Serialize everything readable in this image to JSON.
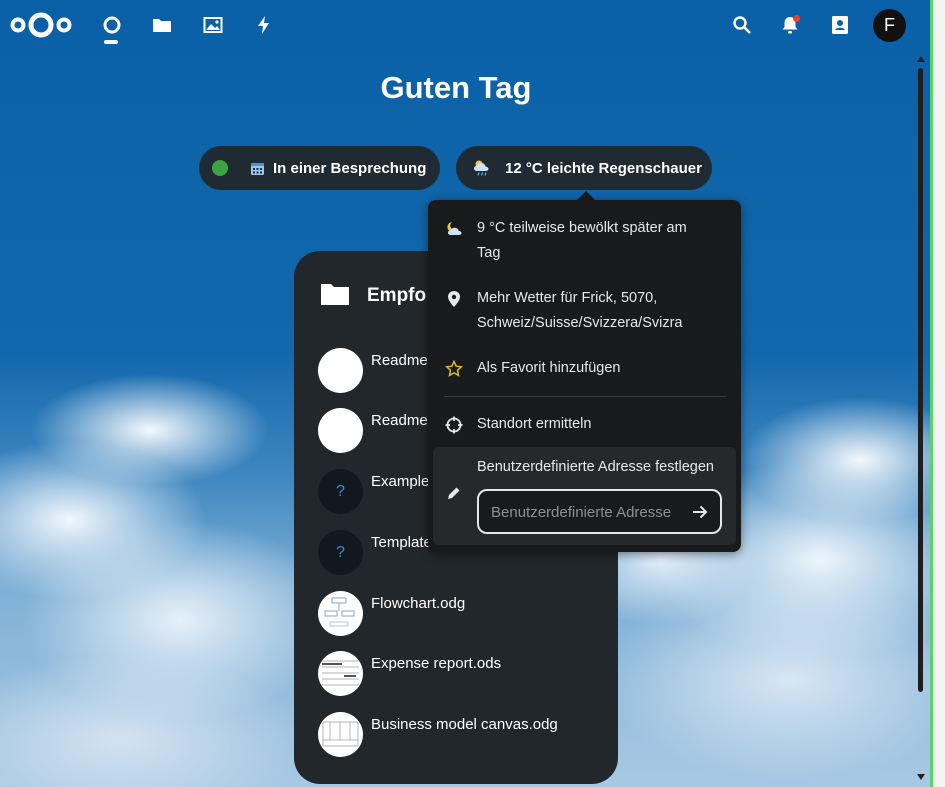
{
  "greeting": "Guten Tag",
  "colors": {
    "header_bg": "#0a60a6",
    "pill_bg": "#1f2a33",
    "status_green": "#3aa542",
    "notification_dot": "#e9432b",
    "panel_bg": "#22272b",
    "popover_bg": "#191a1c"
  },
  "header": {
    "nav": [
      {
        "name": "dashboard",
        "icon": "dashboard-circle-icon",
        "active": true
      },
      {
        "name": "files",
        "icon": "folder-icon"
      },
      {
        "name": "photos",
        "icon": "image-icon"
      },
      {
        "name": "activity",
        "icon": "lightning-icon"
      }
    ],
    "right_icons": [
      "search-icon",
      "bell-icon",
      "contacts-icon"
    ],
    "avatar_letter": "F"
  },
  "status_pill": {
    "label": "In einer Besprechung",
    "icon": "calendar-icon"
  },
  "weather_pill": {
    "label": "12 °C leichte Regenschauer",
    "icon": "rain-cloud-icon"
  },
  "weather_menu": {
    "forecast": "9 °C teilweise bewölkt später am Tag",
    "more_weather": "Mehr Wetter für Frick, 5070, Schweiz/Suisse/Svizzera/Svizra",
    "add_favorite": "Als Favorit hinzufügen",
    "locate": "Standort ermitteln",
    "custom_address_title": "Benutzerdefinierte Adresse festlegen",
    "custom_address_placeholder": "Benutzerdefinierte Adresse"
  },
  "recommendations": {
    "title": "Empfo",
    "files": [
      {
        "name": "Readme.",
        "thumb": "white"
      },
      {
        "name": "Readme.",
        "thumb": "white"
      },
      {
        "name": "Example.",
        "thumb": "unknown",
        "glyph": "?"
      },
      {
        "name": "Template",
        "thumb": "unknown",
        "glyph": "?"
      },
      {
        "name": "Flowchart.odg",
        "thumb": "preview"
      },
      {
        "name": "Expense report.ods",
        "thumb": "preview"
      },
      {
        "name": "Business model canvas.odg",
        "thumb": "preview"
      }
    ]
  }
}
